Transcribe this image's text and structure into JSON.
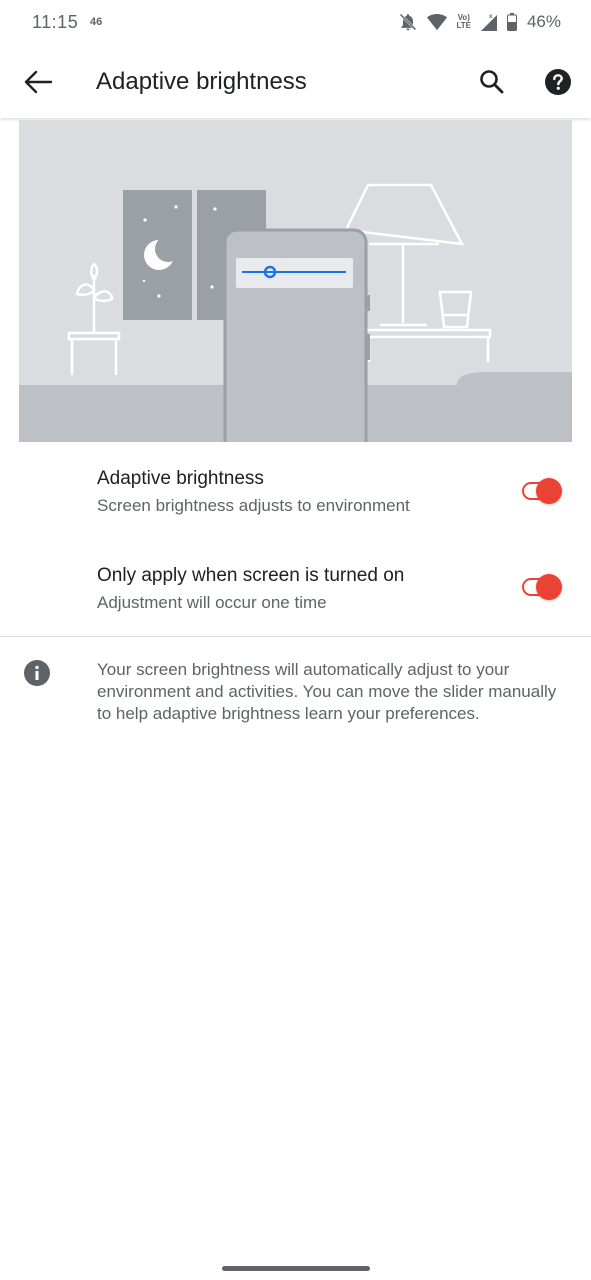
{
  "status_bar": {
    "time": "11:15",
    "network_type": "46",
    "volte_top": "Vo)",
    "volte_bottom": "LTE",
    "battery_percent": "46%"
  },
  "app_bar": {
    "title": "Adaptive brightness",
    "back_icon": "arrow-back-icon",
    "search_icon": "search-icon",
    "help_icon": "help-icon"
  },
  "settings": [
    {
      "title": "Adaptive brightness",
      "summary": "Screen brightness adjusts to environment",
      "enabled": true
    },
    {
      "title": "Only apply when screen is turned on",
      "summary": "Adjustment will occur one time",
      "enabled": true
    }
  ],
  "info": {
    "icon": "info-icon",
    "text": "Your screen brightness will automatically adjust to your environment and activities. You can move the slider manually to help adaptive brightness learn your preferences."
  },
  "colors": {
    "accent": "#ea4335",
    "illustration_bg": "#dadce0",
    "slider": "#1a73e8"
  }
}
